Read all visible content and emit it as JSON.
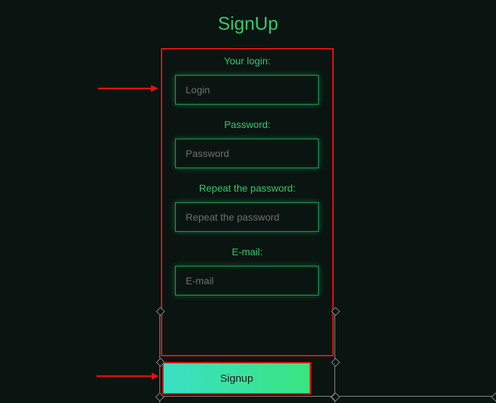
{
  "title": "SignUp",
  "form": {
    "login": {
      "label": "Your login:",
      "placeholder": "Login"
    },
    "password": {
      "label": "Password:",
      "placeholder": "Password"
    },
    "repeat_password": {
      "label": "Repeat the password:",
      "placeholder": "Repeat the password"
    },
    "email": {
      "label": "E-mail:",
      "placeholder": "E-mail"
    }
  },
  "button": {
    "signup_label": "Signup"
  },
  "annotation": {
    "highlight_color": "#e81010",
    "accent_color": "#2ecc71"
  }
}
